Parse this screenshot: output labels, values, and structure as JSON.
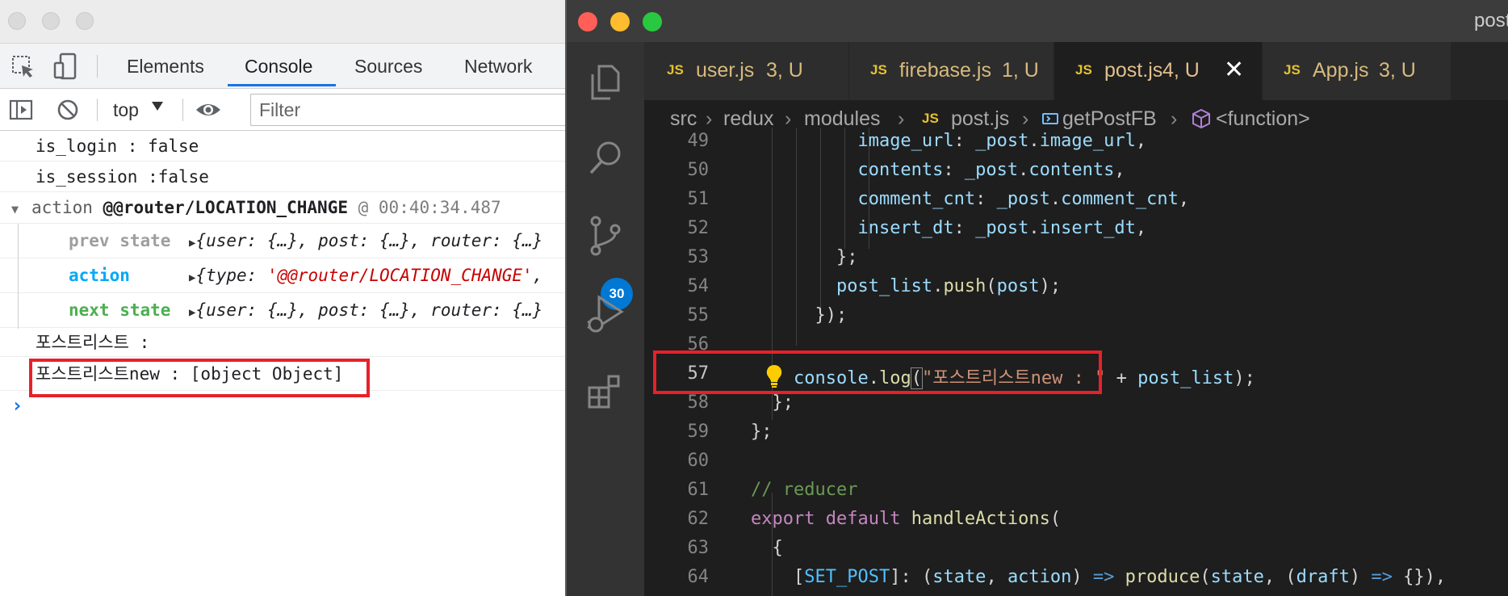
{
  "devtools": {
    "tabs": [
      "Elements",
      "Console",
      "Sources",
      "Network"
    ],
    "context": "top",
    "filter_placeholder": "Filter",
    "console": {
      "line1": "is_login : false",
      "line2": "is_session :false",
      "group_prefix": "action ",
      "group_action": "@@router/LOCATION_CHANGE",
      "group_time": " @ 00:40:34.487",
      "prev_label": "prev state",
      "prev_value": "{user: {…}, post: {…}, router: {…}",
      "action_label": "action",
      "action_value_prefix": "{type: ",
      "action_value_str": "'@@router/LOCATION_CHANGE'",
      "action_value_suffix": ",",
      "next_label": "next state",
      "next_value": "{user: {…}, post: {…}, router: {…}",
      "line_post1": "포스트리스트 :",
      "line_post2": "포스트리스트new : [object Object]",
      "prompt": "›"
    }
  },
  "vscode": {
    "title": "post",
    "scm_badge": "30",
    "tabs": [
      {
        "icon": "JS",
        "name": "user.js",
        "status": "3, U"
      },
      {
        "icon": "JS",
        "name": "firebase.js",
        "status": "1, U"
      },
      {
        "icon": "JS",
        "name": "post.js",
        "status": "4, U",
        "close": "✕"
      },
      {
        "icon": "JS",
        "name": "App.js",
        "status": "3, U"
      }
    ],
    "breadcrumb": [
      "src",
      "redux",
      "modules",
      "post.js",
      "getPostFB",
      "<function>"
    ],
    "code_tokens": {
      "l49": [
        "image_url",
        ": ",
        "_post",
        ".",
        "image_url",
        ","
      ],
      "l50": [
        "contents",
        ": ",
        "_post",
        ".",
        "contents",
        ","
      ],
      "l51": [
        "comment_cnt",
        ": ",
        "_post",
        ".",
        "comment_cnt",
        ","
      ],
      "l52": [
        "insert_dt",
        ": ",
        "_post",
        ".",
        "insert_dt",
        ","
      ],
      "l53": [
        "};"
      ],
      "l54": [
        "post_list",
        ".",
        "push",
        "(",
        "post",
        ");"
      ],
      "l55": [
        "});"
      ],
      "l57": [
        "console",
        ".",
        "log",
        "(",
        "\"포스트리스트new : \"",
        " + ",
        "post_list",
        ");"
      ],
      "l58": [
        "};"
      ],
      "l59": [
        "};"
      ],
      "l61": [
        "// reducer"
      ],
      "l62": [
        "export",
        " ",
        "default",
        " ",
        "handleActions",
        "("
      ],
      "l63": [
        "{"
      ],
      "l64": [
        "[",
        "SET_POST",
        "]",
        ": (",
        "state",
        ", ",
        "action",
        ") ",
        "=>",
        " ",
        "produce",
        "(",
        "state",
        ", (",
        "draft",
        ") ",
        "=>",
        " {}),"
      ]
    },
    "line_numbers": [
      "49",
      "50",
      "51",
      "52",
      "53",
      "54",
      "55",
      "56",
      "57",
      "58",
      "59",
      "60",
      "61",
      "62",
      "63",
      "64"
    ]
  }
}
